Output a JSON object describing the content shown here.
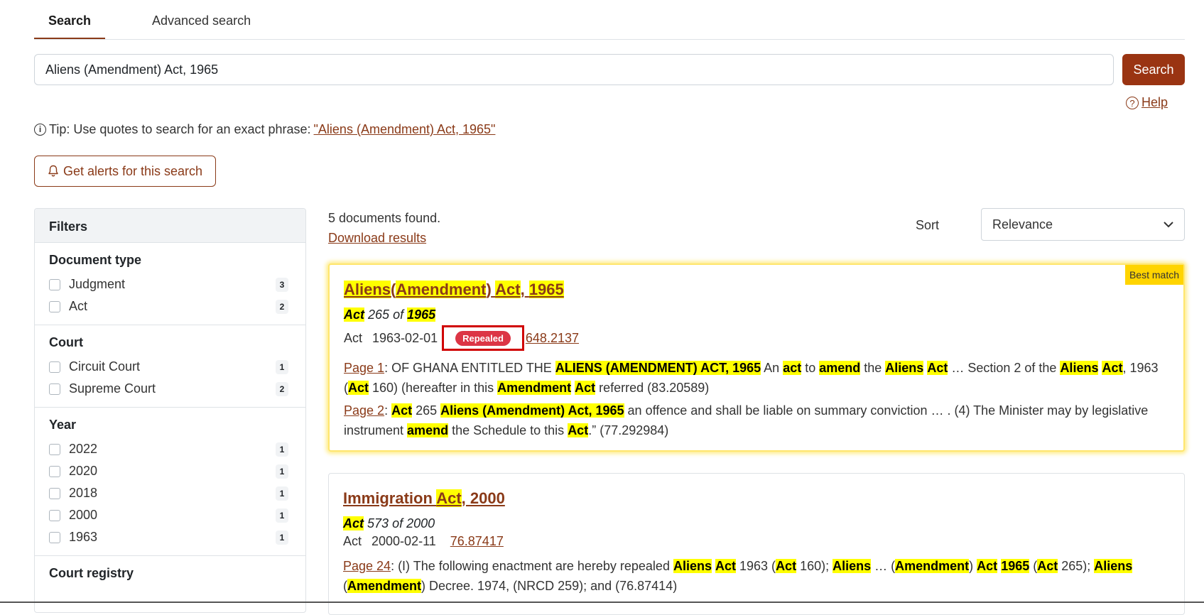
{
  "tabs": {
    "search": "Search",
    "advanced": "Advanced search"
  },
  "search": {
    "query": "Aliens (Amendment) Act, 1965",
    "button": "Search",
    "help": "Help"
  },
  "tip": {
    "prefix": "Tip: Use quotes to search for an exact phrase:",
    "link": "\"Aliens (Amendment) Act, 1965\""
  },
  "alerts": {
    "label": "Get alerts for this search"
  },
  "filters": {
    "heading": "Filters",
    "document_type": {
      "title": "Document type",
      "items": [
        {
          "label": "Judgment",
          "count": "3"
        },
        {
          "label": "Act",
          "count": "2"
        }
      ]
    },
    "court": {
      "title": "Court",
      "items": [
        {
          "label": "Circuit Court",
          "count": "1"
        },
        {
          "label": "Supreme Court",
          "count": "2"
        }
      ]
    },
    "year": {
      "title": "Year",
      "items": [
        {
          "label": "2022",
          "count": "1"
        },
        {
          "label": "2020",
          "count": "1"
        },
        {
          "label": "2018",
          "count": "1"
        },
        {
          "label": "2000",
          "count": "1"
        },
        {
          "label": "1963",
          "count": "1"
        }
      ]
    },
    "court_registry": {
      "title": "Court registry"
    }
  },
  "results": {
    "found": "5 documents found.",
    "download": "Download results",
    "sort_label": "Sort",
    "sort_value": "Relevance",
    "best_match": "Best match",
    "r1": {
      "title_parts": [
        "Aliens",
        "(",
        "Amendment",
        ")",
        "Act",
        ",",
        "1965"
      ],
      "cite_act": "Act",
      "cite_mid": "265 of",
      "cite_year": "1965",
      "type": "Act",
      "date": "1963-02-01",
      "status": "Repealed",
      "score": "648.2137",
      "p1_link": "Page 1",
      "p1": [
        ": OF GHANA ENTITLED THE ",
        "ALIENS (AMENDMENT) ACT, 1965",
        " An ",
        "act",
        " to ",
        "amend",
        " the ",
        "Aliens",
        " ",
        "Act",
        " … Section 2 of the ",
        "Aliens",
        " ",
        "Act",
        ", 1963 (",
        "Act",
        " 160) (hereafter in this ",
        "Amendment",
        " ",
        "Act",
        " referred (83.20589)"
      ],
      "p2_link": "Page 2",
      "p2": [
        ": ",
        "Act",
        " 265 ",
        "Aliens (Amendment) Act, 1965",
        " an offence and shall be liable on summary conviction … . (4) The Minister may by legislative instrument ",
        "amend",
        " the Schedule to this ",
        "Act",
        ".” (77.292984)"
      ]
    },
    "r2": {
      "title_a": "Immigration ",
      "title_b": "Act",
      "title_c": ", 2000",
      "cite_act": "Act",
      "cite_rest": "573 of 2000",
      "type": "Act",
      "date": "2000-02-11",
      "score": "76.87417",
      "p_link": "Page 24",
      "p": [
        ": (I) The following enactment are hereby repealed ",
        "Aliens",
        " ",
        "Act",
        " 1963 (",
        "Act",
        " 160); ",
        "Aliens",
        " … (",
        "Amendment",
        ") ",
        "Act",
        " ",
        "1965",
        " (",
        "Act",
        " 265); ",
        "Aliens",
        " (",
        "Amendment",
        ") Decree. 1974, (NRCD 259); and (76.87414)"
      ]
    }
  }
}
